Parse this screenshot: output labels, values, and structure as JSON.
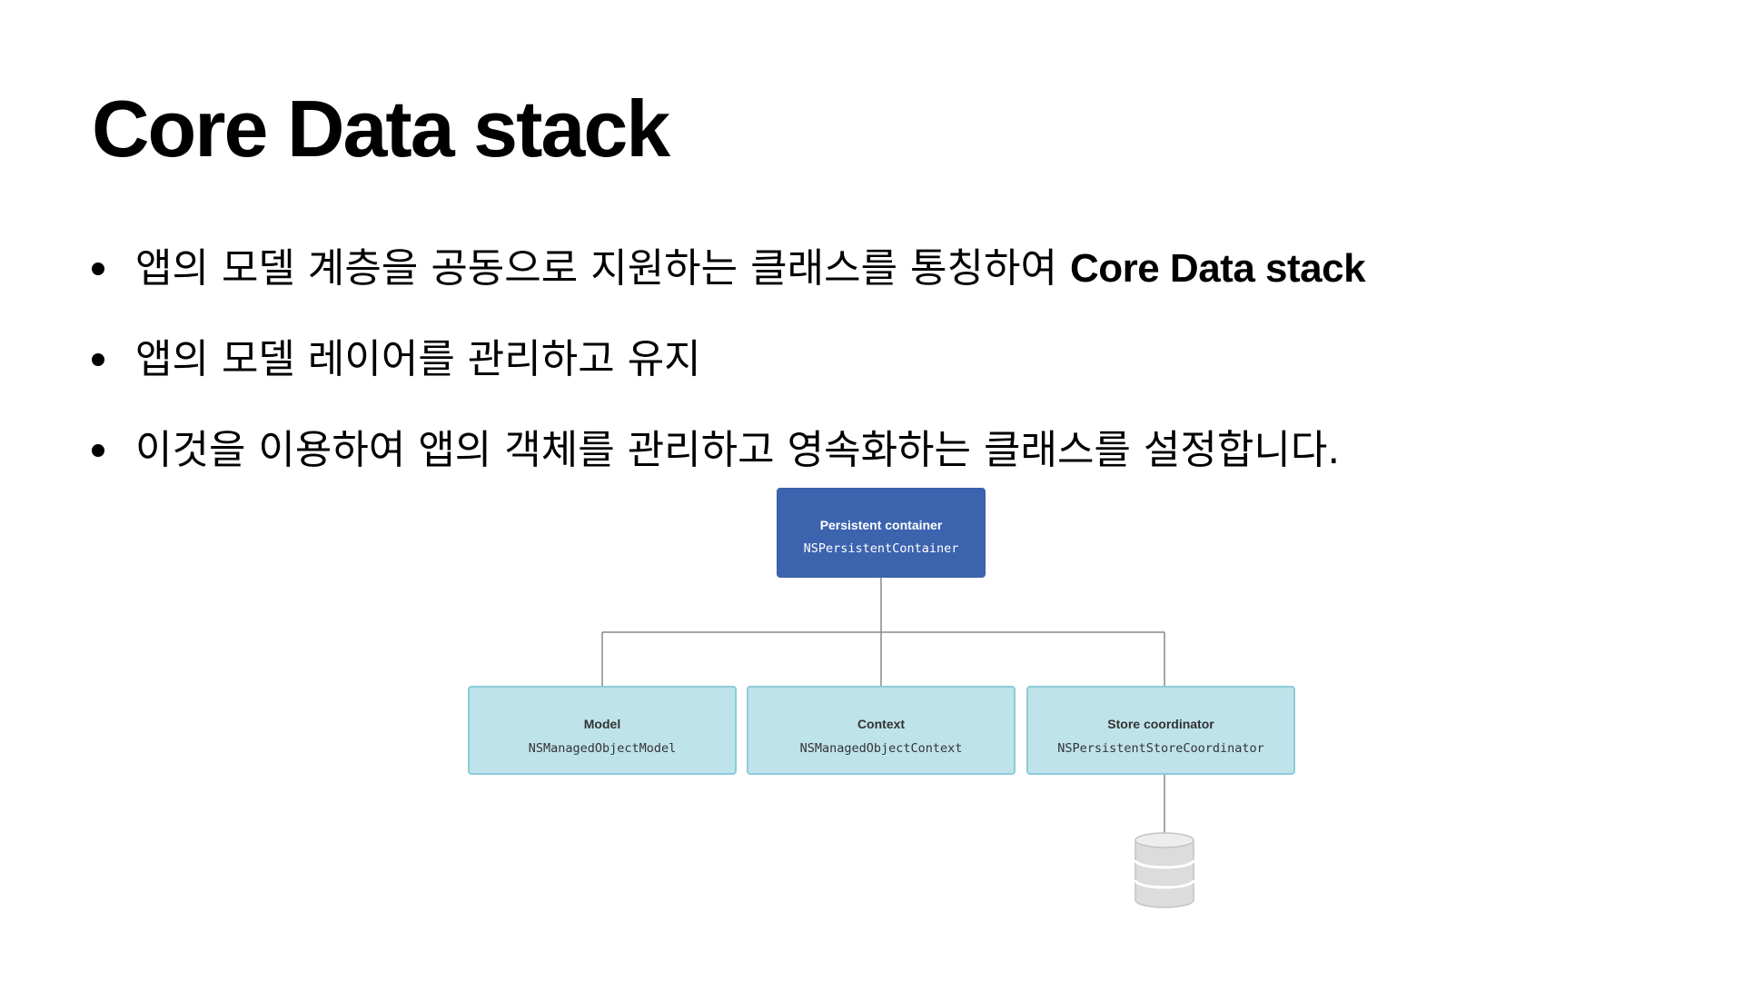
{
  "slide": {
    "title": "Core Data stack",
    "bullets": [
      {
        "text": "앱의 모델 계층을 공동으로 지원하는 클래스를 통칭하여 ",
        "strong": "Core Data stack"
      },
      {
        "text": "앱의 모델 레이어를 관리하고 유지",
        "strong": ""
      },
      {
        "text": "이것을 이용하여 앱의 객체를 관리하고 영속화하는 클래스를 설정합니다.",
        "strong": ""
      }
    ]
  },
  "diagram": {
    "root": {
      "label": "Persistent container",
      "class_name": "NSPersistentContainer"
    },
    "children": [
      {
        "label": "Model",
        "class_name": "NSManagedObjectModel"
      },
      {
        "label": "Context",
        "class_name": "NSManagedObjectContext"
      },
      {
        "label": "Store coordinator",
        "class_name": "NSPersistentStoreCoordinator"
      }
    ],
    "store_icon": "database-icon",
    "colors": {
      "root_fill": "#3c63ae",
      "child_fill": "#bfe3eb",
      "child_border": "#8ccbd9",
      "connector": "#888888",
      "database_fill": "#dcdcdc"
    }
  }
}
